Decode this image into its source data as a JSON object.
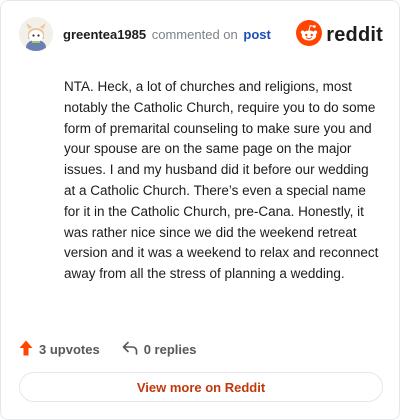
{
  "header": {
    "username": "greentea1985",
    "action_text": "commented on",
    "post_link_label": "post",
    "brand_name": "reddit",
    "avatar_icon": "snoo-avatar-icon",
    "brand_icon": "reddit-logo-icon"
  },
  "comment": {
    "body": "NTA. Heck, a lot of churches and religions, most notably the Catholic Church, require you to do some form of premarital counseling to make sure you and your spouse are on the same page on the major issues. I and my husband did it before our wedding at a Catholic Church. There’s even a special name for it in the Catholic Church, pre-Cana. Honestly, it was rather nice since we did the weekend retreat version and it was a weekend to relax and reconnect away from all the stress of planning a wedding."
  },
  "footer": {
    "upvotes_label": "3 upvotes",
    "replies_label": "0 replies",
    "view_more_label": "View more on Reddit",
    "upvote_icon": "upvote-arrow-icon",
    "reply_icon": "reply-arrow-icon"
  },
  "colors": {
    "brand_orange": "#ff4500",
    "upvote_orange": "#ff4500",
    "link_blue": "#1a4fb8",
    "view_more_text": "#c1380d",
    "muted_text": "#7c8287",
    "border": "#e5e8ea"
  }
}
